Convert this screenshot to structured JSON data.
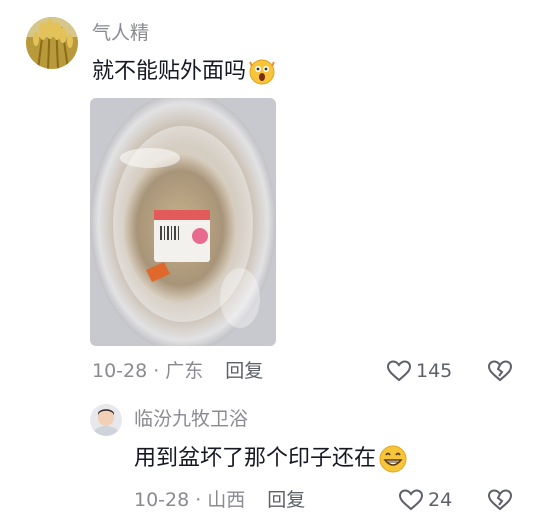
{
  "comments": [
    {
      "username": "气人精",
      "text": "就不能贴外面吗",
      "emoji": "shocked-face-emoji",
      "has_image": true,
      "date": "10-28",
      "location": "广东",
      "reply_label": "回复",
      "likes": "145",
      "avatar": "wheat-field-avatar"
    },
    {
      "username": "临汾九牧卫浴",
      "text": "用到盆坏了那个印子还在",
      "emoji": "grinning-face-emoji",
      "date": "10-28",
      "location": "山西",
      "reply_label": "回复",
      "likes": "24",
      "avatar": "man-portrait-avatar"
    }
  ],
  "separator": "·",
  "colors": {
    "meta": "#8a8b91",
    "text": "#161823",
    "icon": "#5e6069"
  }
}
